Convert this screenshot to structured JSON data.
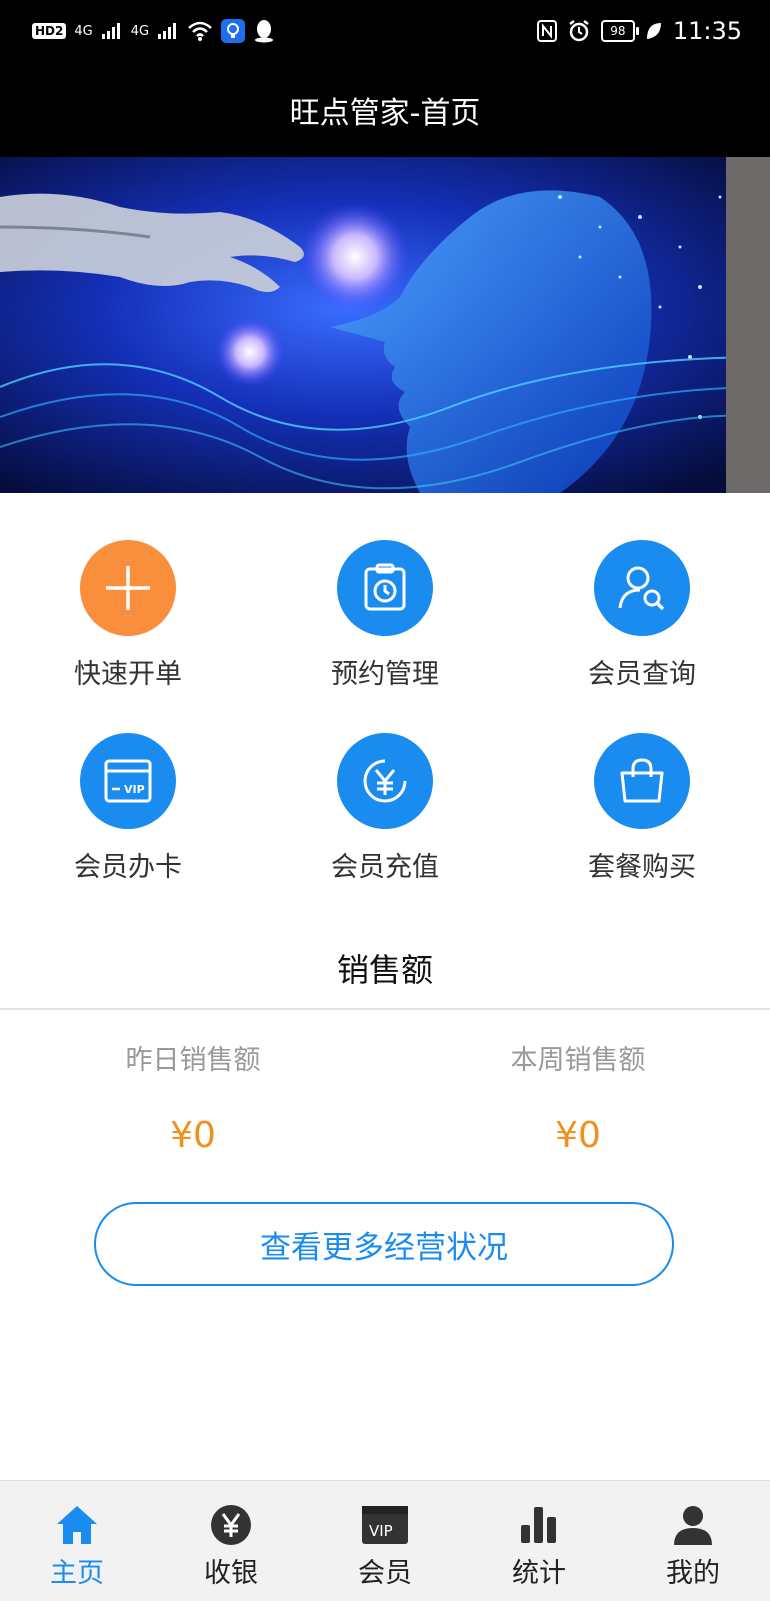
{
  "status_bar": {
    "left_icons": [
      "hd-icon",
      "signal-icon",
      "signal-icon",
      "wifi-icon",
      "app-icon",
      "qq-icon"
    ],
    "hd_text": "HD",
    "hd_sim": "2",
    "net1": "4G",
    "net2": "4G",
    "battery": "98",
    "time": "11:35"
  },
  "header": {
    "title": "旺点管家-首页"
  },
  "actions": [
    {
      "label": "快速开单",
      "icon": "plus-icon",
      "color": "#f98f3c"
    },
    {
      "label": "预约管理",
      "icon": "clipboard-clock-icon",
      "color": "#1a8cf0"
    },
    {
      "label": "会员查询",
      "icon": "user-search-icon",
      "color": "#1a8cf0"
    },
    {
      "label": "会员办卡",
      "icon": "vip-card-icon",
      "color": "#1a8cf0"
    },
    {
      "label": "会员充值",
      "icon": "yuan-coin-icon",
      "color": "#1a8cf0"
    },
    {
      "label": "套餐购买",
      "icon": "shopping-bag-icon",
      "color": "#1a8cf0"
    }
  ],
  "sales": {
    "title": "销售额",
    "yesterday_label": "昨日销售额",
    "yesterday_value": "¥0",
    "week_label": "本周销售额",
    "week_value": "¥0"
  },
  "more_button": "查看更多经营状况",
  "tabbar": [
    {
      "label": "主页",
      "icon": "home-icon",
      "active": true
    },
    {
      "label": "收银",
      "icon": "yuan-icon",
      "active": false
    },
    {
      "label": "会员",
      "icon": "vip-icon",
      "active": false
    },
    {
      "label": "统计",
      "icon": "bar-chart-icon",
      "active": false
    },
    {
      "label": "我的",
      "icon": "person-icon",
      "active": false
    }
  ],
  "colors": {
    "accent": "#1a8cf0",
    "orange": "#f98f3c",
    "money": "#f0911e"
  }
}
